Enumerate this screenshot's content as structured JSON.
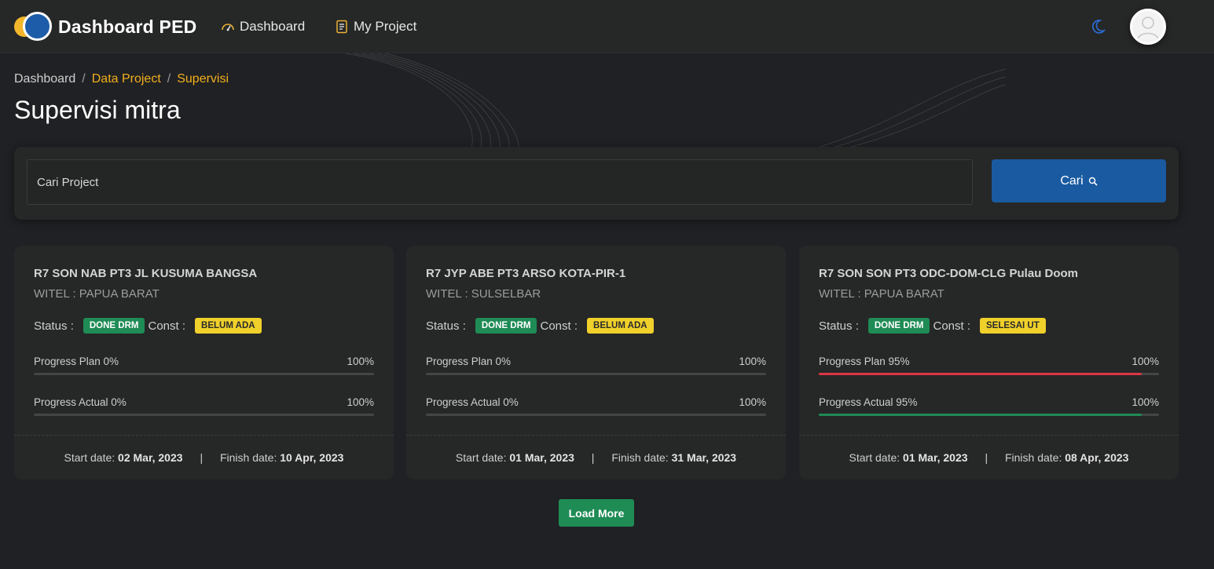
{
  "navbar": {
    "brand": "Dashboard PED",
    "links": [
      {
        "label": "Dashboard",
        "icon": "speedometer-icon"
      },
      {
        "label": "My Project",
        "icon": "notebook-icon"
      }
    ],
    "theme_icon": "moon-icon",
    "avatar_icon": "user-avatar-icon"
  },
  "breadcrumb": {
    "home": "Dashboard",
    "sep": "/",
    "items": [
      "Data Project",
      "Supervisi"
    ]
  },
  "page": {
    "title": "Supervisi mitra"
  },
  "search": {
    "placeholder": "Cari Project",
    "button_label": "Cari",
    "button_icon": "search-icon"
  },
  "colors": {
    "accent_blue": "#1a5aa0",
    "link_yellow": "#f2b01e",
    "badge_green": "#1f8b55",
    "badge_yellow": "#f0d02a",
    "progress_red": "#dc3545"
  },
  "cards": [
    {
      "title": "R7 SON NAB PT3 JL KUSUMA BANGSA",
      "witel": "WITEL : PAPUA BARAT",
      "status_label": "Status :",
      "status_badge": "DONE DRM",
      "const_label": "Const :",
      "const_badge": "BELUM ADA",
      "plan_label": "Progress Plan 0%",
      "plan_max": "100%",
      "plan_value": 0,
      "actual_label": "Progress Actual 0%",
      "actual_max": "100%",
      "actual_value": 0,
      "start_label": "Start date:",
      "start_date": "02 Mar, 2023",
      "finish_label": "Finish date:",
      "finish_date": "10 Apr, 2023"
    },
    {
      "title": "R7 JYP ABE PT3 ARSO KOTA-PIR-1",
      "witel": "WITEL : SULSELBAR",
      "status_label": "Status :",
      "status_badge": "DONE DRM",
      "const_label": "Const :",
      "const_badge": "BELUM ADA",
      "plan_label": "Progress Plan 0%",
      "plan_max": "100%",
      "plan_value": 0,
      "actual_label": "Progress Actual 0%",
      "actual_max": "100%",
      "actual_value": 0,
      "start_label": "Start date:",
      "start_date": "01 Mar, 2023",
      "finish_label": "Finish date:",
      "finish_date": "31 Mar, 2023"
    },
    {
      "title": "R7 SON SON PT3 ODC-DOM-CLG Pulau Doom",
      "witel": "WITEL : PAPUA BARAT",
      "status_label": "Status :",
      "status_badge": "DONE DRM",
      "const_label": "Const :",
      "const_badge": "SELESAI UT",
      "plan_label": "Progress Plan 95%",
      "plan_max": "100%",
      "plan_value": 95,
      "actual_label": "Progress Actual 95%",
      "actual_max": "100%",
      "actual_value": 95,
      "start_label": "Start date:",
      "start_date": "01 Mar, 2023",
      "finish_label": "Finish date:",
      "finish_date": "08 Apr, 2023"
    }
  ],
  "load_more": "Load More",
  "date_separator": "|"
}
